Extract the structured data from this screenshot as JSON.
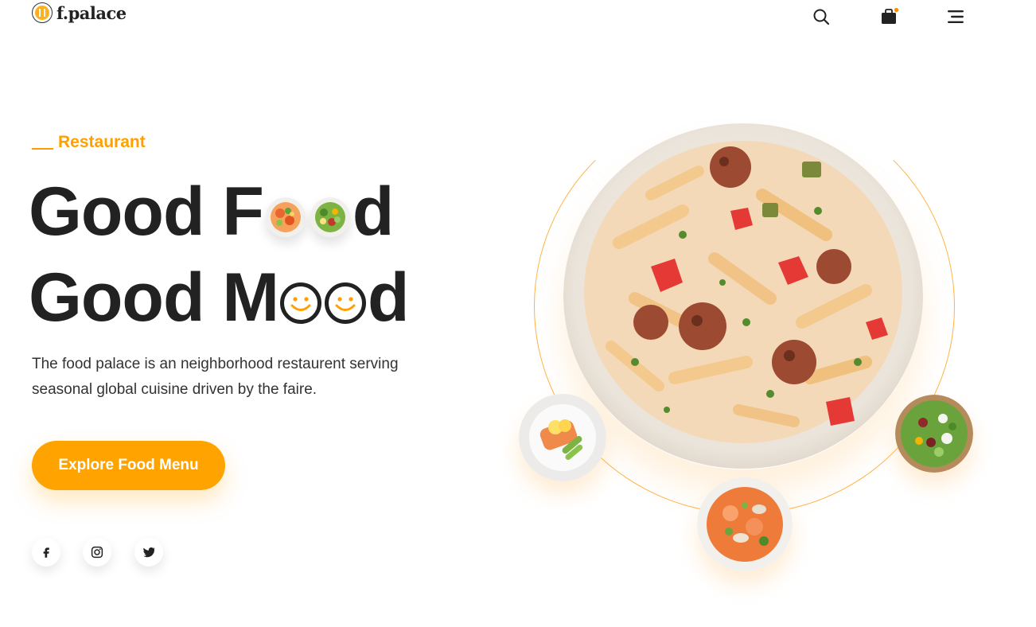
{
  "brand": {
    "name": "f.palace",
    "accent": "#ffa300"
  },
  "header": {
    "icons": [
      "search-icon",
      "shopping-bag-icon",
      "menu-icon"
    ],
    "cart_has_items": true
  },
  "hero": {
    "eyebrow": "Restaurant",
    "headline_line1": {
      "before": "Good F",
      "after": "d"
    },
    "headline_line2": {
      "before": "Good M",
      "after": "d"
    },
    "description": "The food palace is an neighborhood restaurent serving seasonal global cuisine driven by the faire.",
    "cta_label": "Explore Food Menu"
  },
  "social": [
    "facebook-icon",
    "instagram-icon",
    "twitter-icon"
  ],
  "showcase": {
    "main_dish": "pasta-meatballs-bowl",
    "side_dishes": [
      "salmon-plate",
      "seafood-soup-bowl",
      "salad-bowl"
    ]
  }
}
